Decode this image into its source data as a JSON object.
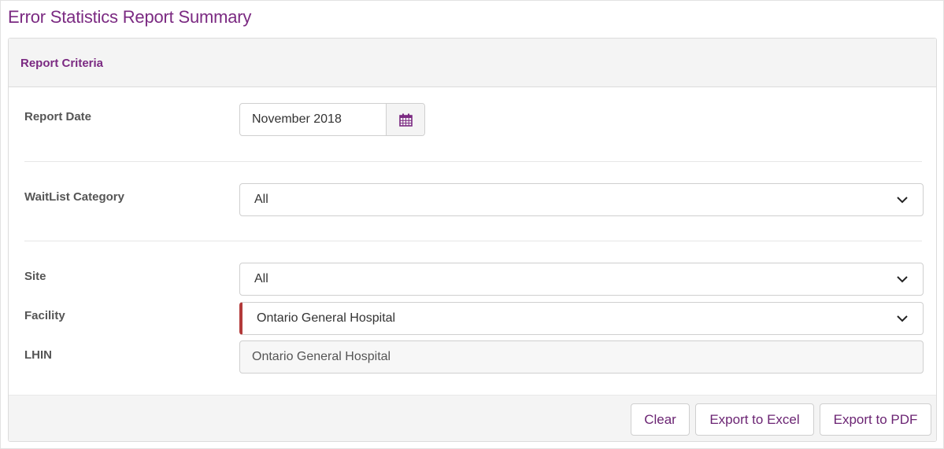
{
  "page": {
    "title": "Error Statistics Report Summary"
  },
  "panel": {
    "title": "Report Criteria"
  },
  "fields": {
    "report_date": {
      "label": "Report Date",
      "value": "November 2018",
      "icon": "calendar-icon"
    },
    "waitlist_category": {
      "label": "WaitList Category",
      "value": "All"
    },
    "site": {
      "label": "Site",
      "value": "All"
    },
    "facility": {
      "label": "Facility",
      "value": "Ontario General Hospital"
    },
    "lhin": {
      "label": "LHIN",
      "value": "Ontario General Hospital"
    }
  },
  "actions": {
    "clear": "Clear",
    "export_excel": "Export to Excel",
    "export_pdf": "Export to PDF"
  },
  "colors": {
    "accent": "#7b2a82",
    "required": "#b23a3a",
    "panel_bg": "#f4f4f4"
  }
}
